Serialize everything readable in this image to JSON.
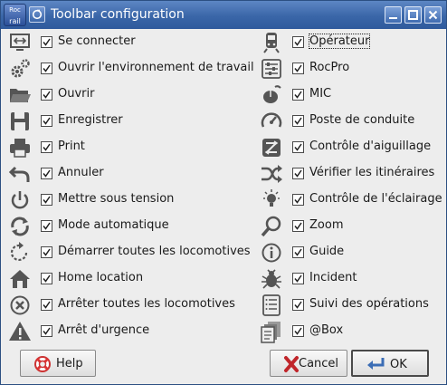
{
  "window": {
    "app_icon_line1": "Roc",
    "app_icon_line2": "rail",
    "title": "Toolbar configuration"
  },
  "left_items": [
    {
      "icon": "connect-monitor-icon",
      "label": "Se connecter",
      "checked": true
    },
    {
      "icon": "gears-icon",
      "label": "Ouvrir l'environnement de travail",
      "checked": true
    },
    {
      "icon": "folder-open-icon",
      "label": "Ouvrir",
      "checked": true
    },
    {
      "icon": "floppy-disk-icon",
      "label": "Enregistrer",
      "checked": true
    },
    {
      "icon": "printer-icon",
      "label": "Print",
      "checked": true
    },
    {
      "icon": "undo-arrow-icon",
      "label": "Annuler",
      "checked": true
    },
    {
      "icon": "power-icon",
      "label": "Mettre sous tension",
      "checked": true
    },
    {
      "icon": "loop-arrows-icon",
      "label": "Mode automatique",
      "checked": true
    },
    {
      "icon": "rotate-dashed-icon",
      "label": "Démarrer toutes les locomotives",
      "checked": true
    },
    {
      "icon": "home-icon",
      "label": "Home location",
      "checked": true
    },
    {
      "icon": "stop-circle-x-icon",
      "label": "Arrêter toutes les locomotives",
      "checked": true
    },
    {
      "icon": "warning-triangle-icon",
      "label": "Arrêt d'urgence",
      "checked": true
    }
  ],
  "right_items": [
    {
      "icon": "train-icon",
      "label": "Opérateur",
      "checked": true
    },
    {
      "icon": "sliders-icon",
      "label": "RocPro",
      "checked": true
    },
    {
      "icon": "mic-mouse-icon",
      "label": "MIC",
      "checked": true
    },
    {
      "icon": "speedometer-icon",
      "label": "Poste de conduite",
      "checked": true
    },
    {
      "icon": "turnout-switch-icon",
      "label": "Contrôle d'aiguillage",
      "checked": true
    },
    {
      "icon": "shuffle-icon",
      "label": "Vérifier les itinéraires",
      "checked": true
    },
    {
      "icon": "lightbulb-icon",
      "label": "Contrôle de l'éclairage",
      "checked": true
    },
    {
      "icon": "magnifier-icon",
      "label": "Zoom",
      "checked": true
    },
    {
      "icon": "info-circle-icon",
      "label": "Guide",
      "checked": true
    },
    {
      "icon": "bug-icon",
      "label": "Incident",
      "checked": true
    },
    {
      "icon": "list-icon",
      "label": "Suivi des opérations",
      "checked": true
    },
    {
      "icon": "documents-icon",
      "label": "@Box",
      "checked": true
    }
  ],
  "buttons": {
    "help": "Help",
    "cancel": "Cancel",
    "ok": "OK"
  },
  "colors": {
    "titlebar": "#3a66a8",
    "icon_gray": "#555555"
  }
}
